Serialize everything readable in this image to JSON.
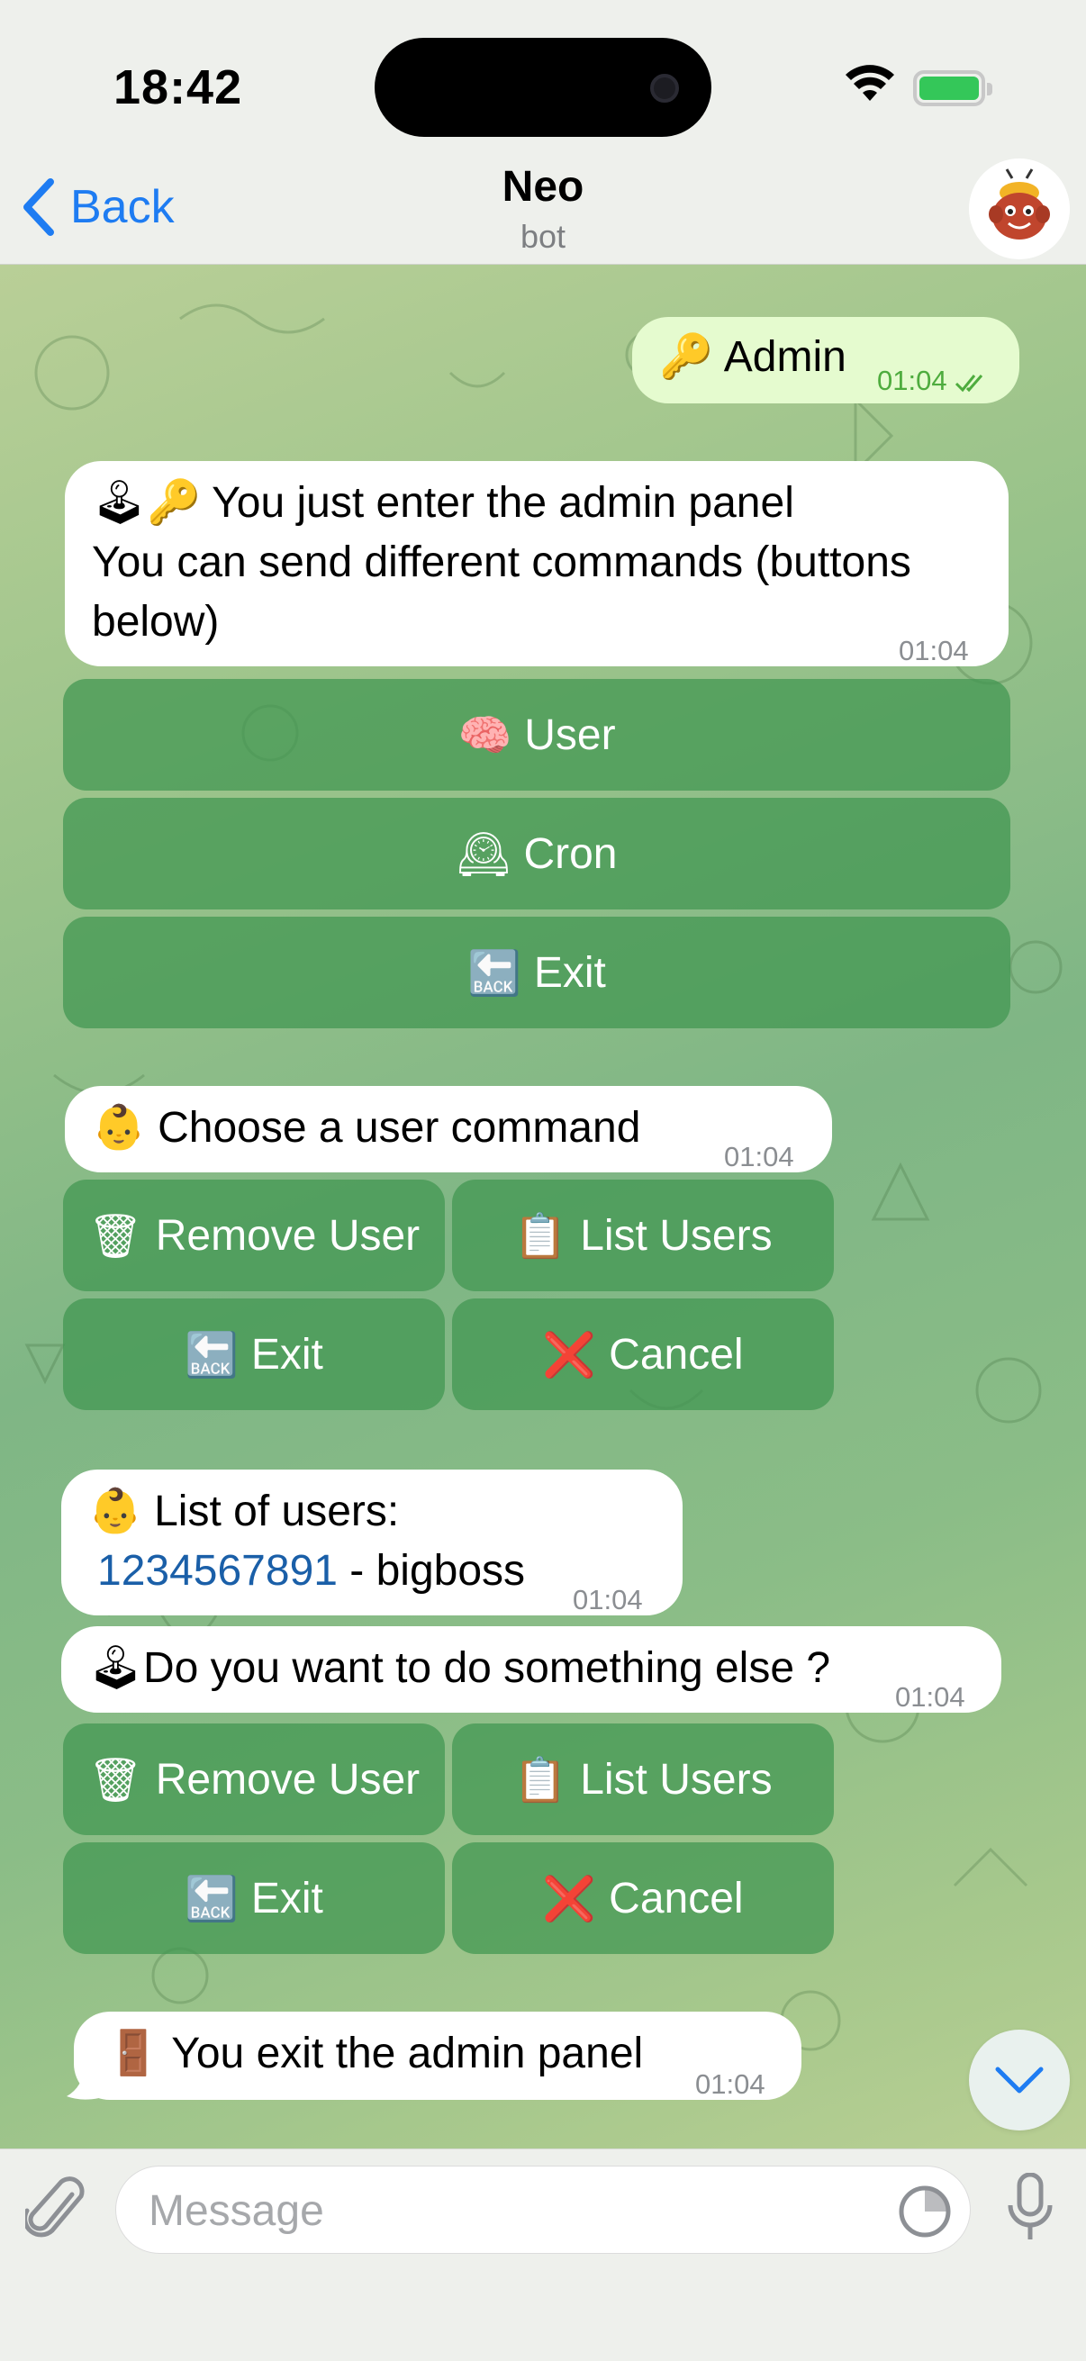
{
  "status_bar": {
    "time": "18:42"
  },
  "header": {
    "back_label": "Back",
    "title": "Neo",
    "subtitle": "bot"
  },
  "messages": {
    "admin": {
      "text": "Admin",
      "time": "01:04"
    },
    "panel": {
      "line1": "You just enter the admin panel",
      "line2": "You can send different commands (buttons below)",
      "time": "01:04"
    },
    "panel_buttons": {
      "user": "User",
      "cron": "Cron",
      "exit": "Exit"
    },
    "choose": {
      "text": "Choose a user command",
      "time": "01:04"
    },
    "user_buttons": {
      "remove": "Remove User",
      "list": "List Users",
      "exit": "Exit",
      "cancel": "Cancel"
    },
    "list": {
      "title": "List of users:",
      "user_id": "1234567891",
      "user_name": " - bigboss",
      "time": "01:04"
    },
    "else": {
      "text": "Do you want to do something else ?",
      "time": "01:04"
    },
    "user_buttons_2": {
      "remove": "Remove User",
      "list": "List Users",
      "exit": "Exit",
      "cancel": "Cancel"
    },
    "exit_msg": {
      "text": "You exit the admin panel",
      "time": "01:04"
    }
  },
  "input": {
    "placeholder": "Message"
  },
  "colors": {
    "accent": "#1e7cf2",
    "outgoing_bubble": "#e5fbcf",
    "keyboard_button": "#4a9a5a",
    "read_check": "#4eac3e"
  },
  "icons": [
    "back-chevron-icon",
    "bot-avatar-icon",
    "key-icon",
    "joystick-icon",
    "brain-icon",
    "clock-icon",
    "back-arrow-icon",
    "baby-icon",
    "trash-icon",
    "clipboard-icon",
    "cross-icon",
    "door-icon",
    "chevron-down-icon",
    "paperclip-icon",
    "sticker-icon",
    "microphone-icon"
  ]
}
